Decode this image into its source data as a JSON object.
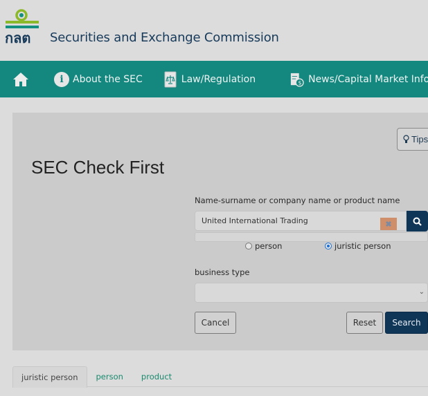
{
  "header": {
    "logo_text": "กลต",
    "site_title": "Securities and Exchange Commission"
  },
  "nav": {
    "items": [
      {
        "label": "",
        "icon": "home-icon"
      },
      {
        "label": "About the SEC",
        "icon": "info-icon"
      },
      {
        "label": "Law/Regulation",
        "icon": "law-document-icon"
      },
      {
        "label": "News/Capital Market Inform",
        "icon": "news-money-icon"
      }
    ]
  },
  "main": {
    "title": "SEC Check First",
    "tips_label": "Tips",
    "search": {
      "label": "Name-surname or company name or product name",
      "value": "United International Trading",
      "clear_glyph": "✖"
    },
    "entity_type": {
      "options": [
        {
          "label": "person",
          "checked": false
        },
        {
          "label": "juristic person",
          "checked": true
        }
      ]
    },
    "business_type": {
      "label": "business type",
      "selected": "",
      "chevron": "⌄"
    },
    "buttons": {
      "cancel": "Cancel",
      "reset": "Reset",
      "search": "Search"
    }
  },
  "tabs": [
    {
      "label": "juristic person",
      "active": true
    },
    {
      "label": "person",
      "active": false
    },
    {
      "label": "product",
      "active": false
    }
  ],
  "colors": {
    "nav_bg": "#14877e",
    "primary_dark": "#0f3557",
    "tab_link": "#1a8a6e",
    "clear_btn": "#cf8f6a"
  }
}
